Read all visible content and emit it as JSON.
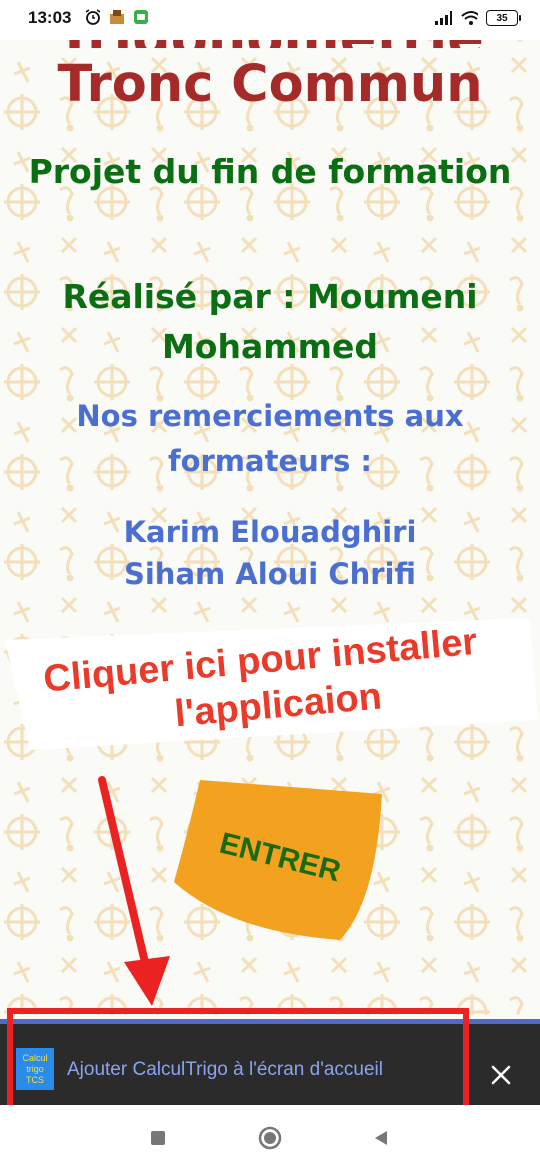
{
  "status_bar": {
    "time": "13:03",
    "battery": "35",
    "icons": [
      "alarm-icon",
      "app-notification-icon",
      "android-icon",
      "signal-icon",
      "wifi-icon",
      "battery-icon"
    ]
  },
  "page": {
    "title_top_partial": "Trigonométrie",
    "title": "Tronc Commun",
    "project_line": "Projet du fin de formation",
    "author_line": "Réalisé par : Moumeni Mohammed",
    "thanks_line": "Nos remerciements aux formateurs :",
    "trainer_1": "Karim Elouadghiri",
    "trainer_2": "Siham Aloui Chrifi",
    "install_hint_line1": "Cliquer ici pour installer",
    "install_hint_line2": "l'applicaion",
    "enter_button": "ENTRER"
  },
  "install_banner": {
    "logo_line1": "Calcul",
    "logo_line2": "trigo",
    "logo_line3": "TCS",
    "text": "Ajouter CalculTrigo à l'écran d'accueil"
  },
  "colors": {
    "title": "#a52a2a",
    "green_text": "#0a6e12",
    "blue_text": "#4a6fd0",
    "hint_red": "#ea3a2a",
    "enter_orange": "#f2a21e",
    "banner_bg": "#2b2b2b",
    "banner_accent": "#4f6ac9"
  }
}
